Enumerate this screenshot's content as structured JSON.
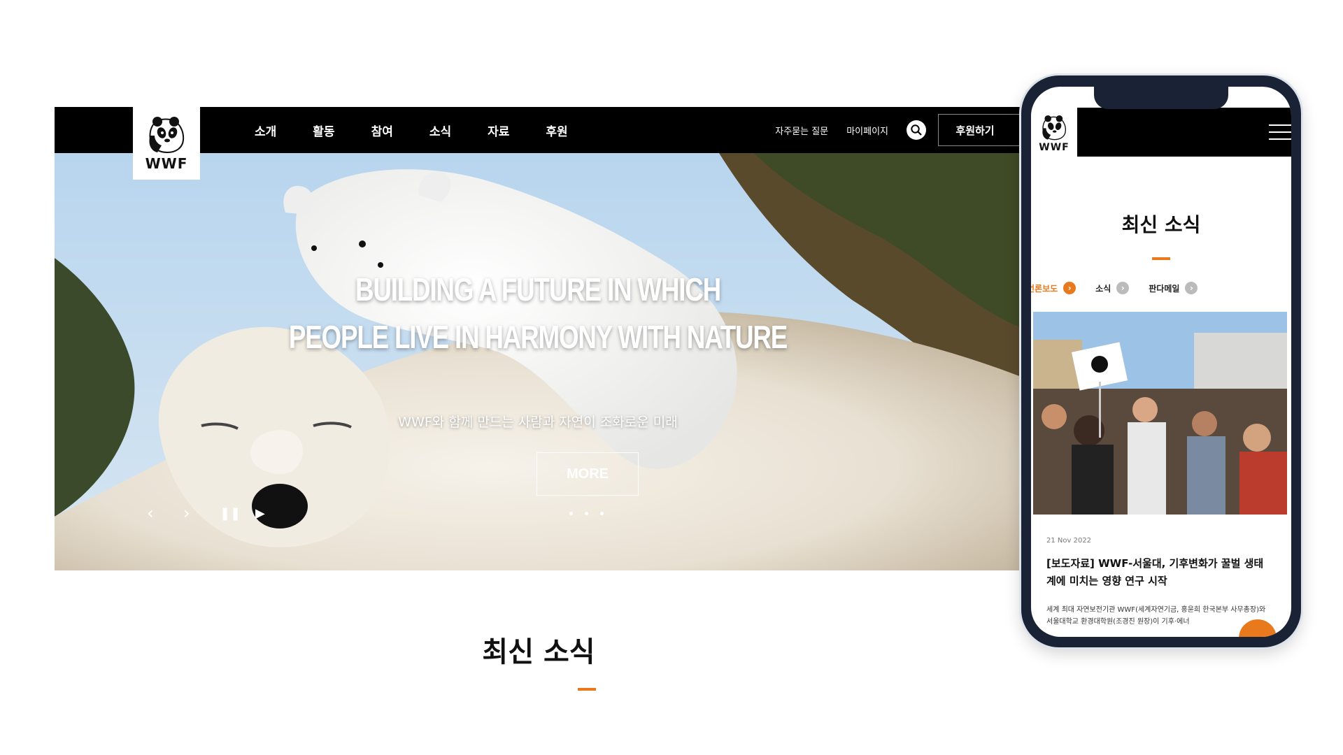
{
  "brand": {
    "logo_text": "WWF"
  },
  "nav": {
    "items": [
      "소개",
      "활동",
      "참여",
      "소식",
      "자료",
      "후원"
    ],
    "faq": "자주묻는 질문",
    "mypage": "마이페이지",
    "donate": "후원하기"
  },
  "hero": {
    "line1": "BUILDING A FUTURE IN WHICH",
    "line2": "PEOPLE LIVE IN HARMONY WITH NATURE",
    "subtitle": "WWF와 함께 만드는 사람과 자연이 조화로운 미래",
    "more": "MORE",
    "slide_count": 3
  },
  "news_section": {
    "title": "최신 소식"
  },
  "mobile": {
    "title": "최신 소식",
    "tabs": [
      "언론보도",
      "소식",
      "판다메일"
    ],
    "active_tab": 0,
    "article": {
      "date": "21 Nov 2022",
      "headline": "[보도자료] WWF-서울대, 기후변화가 꿀벌 생태계에 미치는 영향 연구 시작",
      "body": "세계 최대 자연보전기관 WWF(세계자연기금, 홍윤희 한국본부 사무총장)와 서울대학교 환경대학원(조경진 원장)이 기후·에너"
    }
  },
  "colors": {
    "accent": "#e87a1d",
    "nav_bg": "#000000",
    "phone_frame": "#1a2236"
  }
}
